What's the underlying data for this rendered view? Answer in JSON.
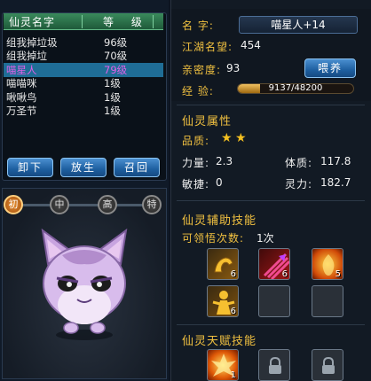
{
  "sprite_list": {
    "header": {
      "name": "仙灵名字",
      "level": "等 级"
    },
    "rows": [
      {
        "name": "组我掉垃圾",
        "level": "96级"
      },
      {
        "name": "组我掉垃",
        "level": "70级"
      },
      {
        "name": "喵星人",
        "level": "79级",
        "selected": true
      },
      {
        "name": "喵喵咪",
        "level": "1级"
      },
      {
        "name": "啾啾鸟",
        "level": "1级"
      },
      {
        "name": "万圣节",
        "level": "1级"
      }
    ]
  },
  "buttons": {
    "unload": "卸下",
    "deploy": "放生",
    "recall": "召回"
  },
  "tiers": [
    "初",
    "中",
    "高",
    "特"
  ],
  "info": {
    "name_label": "名  字:",
    "name_value": "喵星人+14",
    "fame_label": "江湖名望:",
    "fame_value": "454",
    "intimacy_label": "亲密度:",
    "intimacy_value": "93",
    "feed_button": "喂养",
    "exp_label": "经  验:",
    "exp_text": "9137/48200",
    "exp_fraction": 0.1896
  },
  "attributes": {
    "title": "仙灵属性",
    "quality_label": "品质:",
    "quality_stars": 2,
    "str_label": "力量:",
    "str_value": "2.3",
    "con_label": "体质:",
    "con_value": "117.8",
    "agi_label": "敏捷:",
    "agi_value": "0",
    "spi_label": "灵力:",
    "spi_value": "182.7"
  },
  "assist_skills": {
    "title": "仙灵辅助技能",
    "learn_label": "可领悟次数:",
    "learn_value": "1次",
    "skills": [
      {
        "icon": "flexed-arm-icon",
        "count": "6"
      },
      {
        "icon": "claw-strike-icon",
        "count": "6"
      },
      {
        "icon": "flame-face-icon",
        "count": "5"
      },
      {
        "icon": "golden-figure-icon",
        "count": "6"
      },
      {
        "icon": "empty-slot",
        "count": ""
      },
      {
        "icon": "empty-slot",
        "count": ""
      }
    ]
  },
  "talent_skills": {
    "title": "仙灵天赋技能",
    "skills": [
      {
        "icon": "fire-burst-icon",
        "count": "1"
      },
      {
        "icon": "lock-icon",
        "count": ""
      },
      {
        "icon": "lock-icon",
        "count": ""
      }
    ]
  },
  "colors": {
    "accent": "#f0c040",
    "selected_row": "#1f6d96",
    "button": "#1e5fa0"
  }
}
